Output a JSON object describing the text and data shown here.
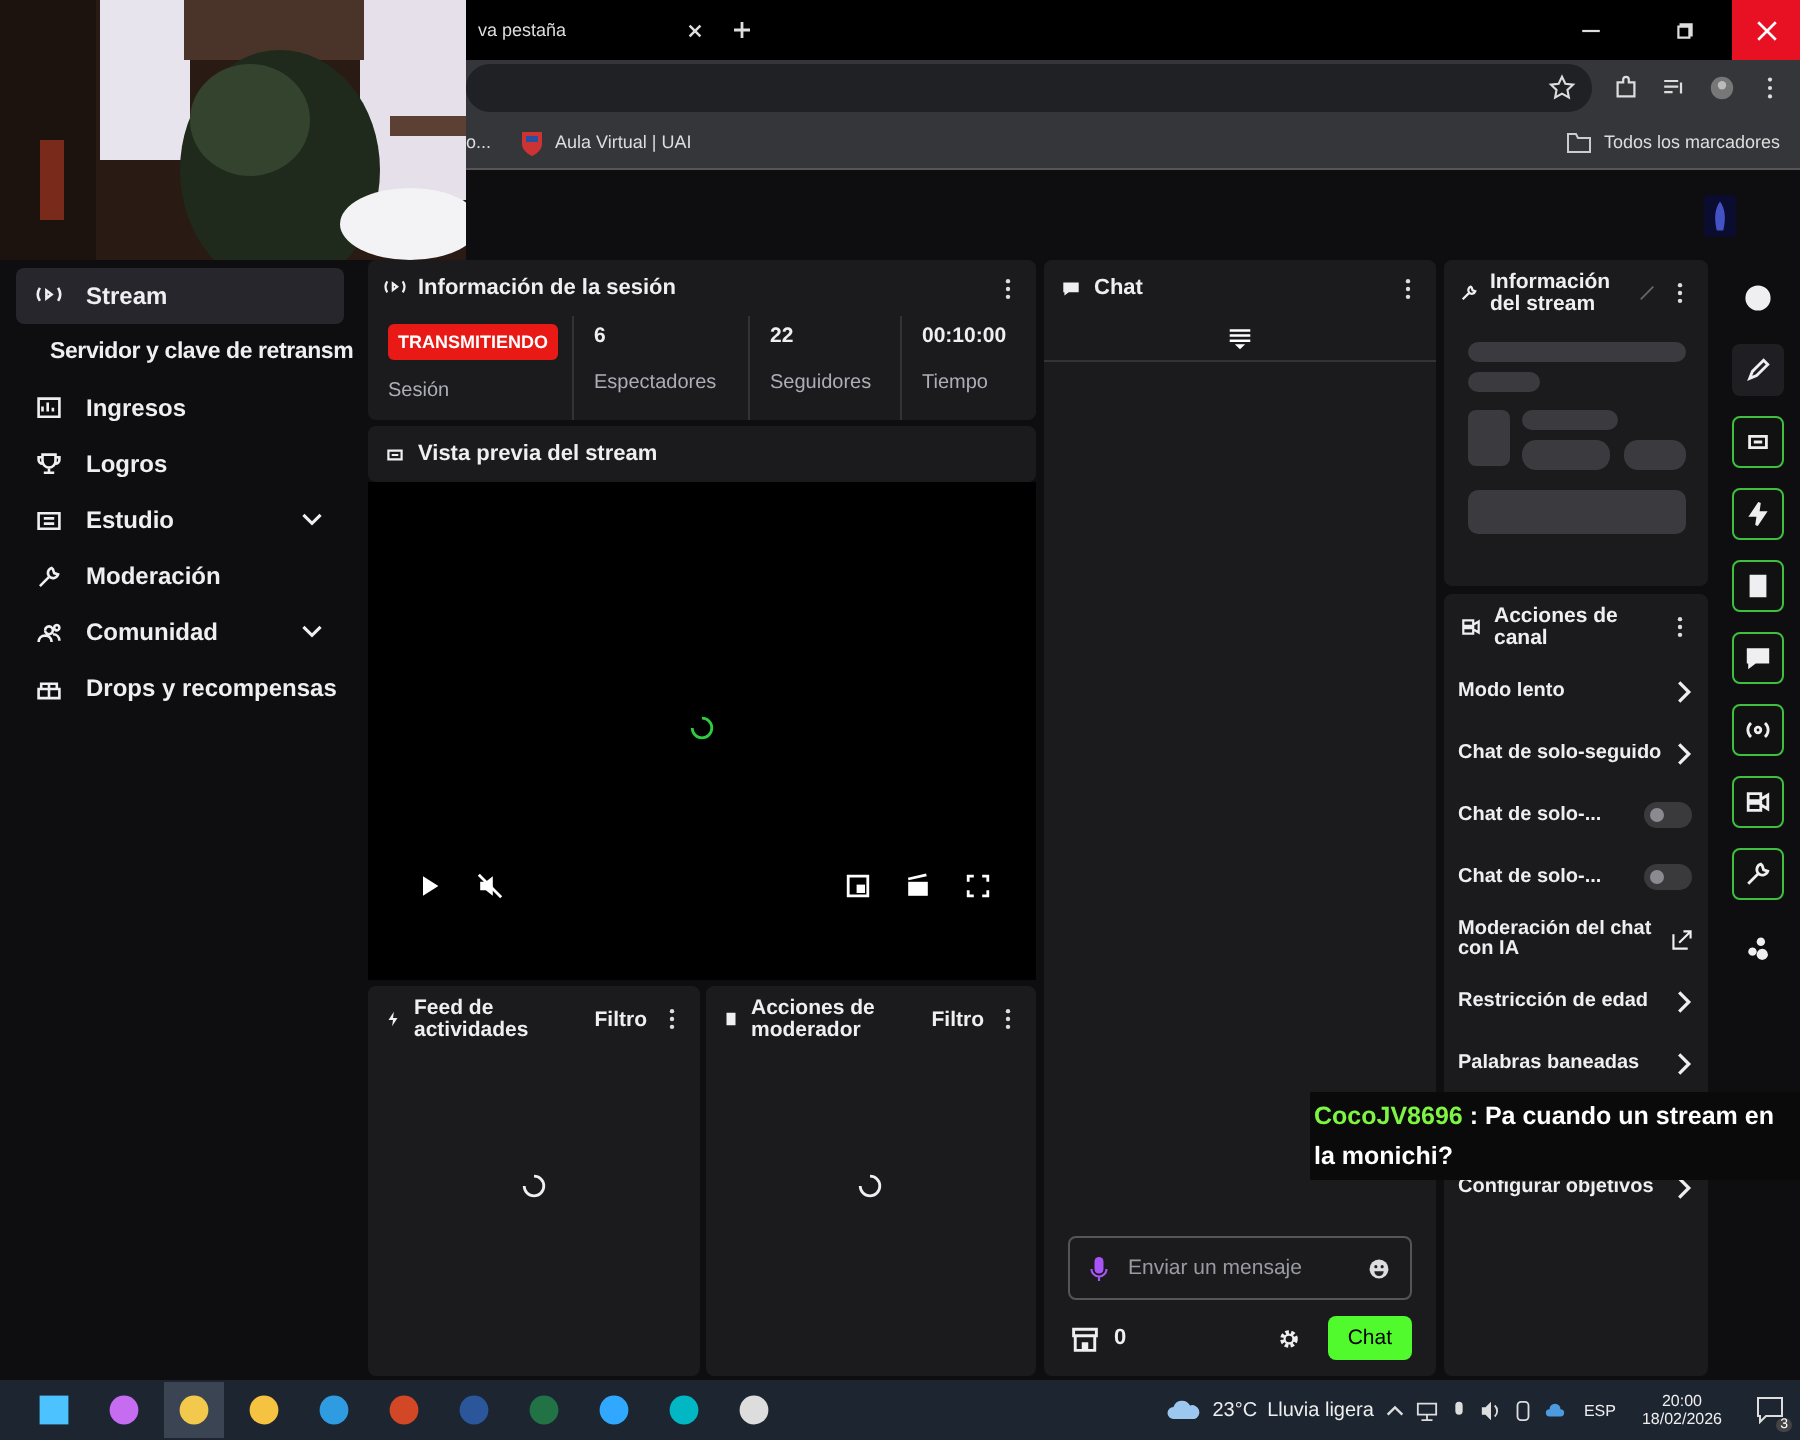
{
  "browser": {
    "tab": {
      "title": "va pestaña"
    },
    "bookmarks": [
      {
        "label": "o..."
      },
      {
        "label": "Aula Virtual | UAI"
      }
    ],
    "all_bookmarks": "Todos los marcadores"
  },
  "sidebar": {
    "items": [
      {
        "label": "Stream",
        "kind": "item",
        "selected": true,
        "expandable": false
      },
      {
        "label": "Servidor y clave de retransm",
        "kind": "subitem",
        "selected": false,
        "expandable": false
      },
      {
        "label": "Ingresos",
        "kind": "item",
        "selected": false,
        "expandable": false
      },
      {
        "label": "Logros",
        "kind": "item",
        "selected": false,
        "expandable": false
      },
      {
        "label": "Estudio",
        "kind": "item",
        "selected": false,
        "expandable": true
      },
      {
        "label": "Moderación",
        "kind": "item",
        "selected": false,
        "expandable": false
      },
      {
        "label": "Comunidad",
        "kind": "item",
        "selected": false,
        "expandable": true
      },
      {
        "label": "Drops y recompensas",
        "kind": "item",
        "selected": false,
        "expandable": false
      }
    ]
  },
  "session": {
    "title": "Información de la sesión",
    "status": "TRANSMITIENDO",
    "status_label": "Sesión",
    "stats": [
      {
        "value": "6",
        "label": "Espectadores"
      },
      {
        "value": "22",
        "label": "Seguidores"
      },
      {
        "value": "00:10:00",
        "label": "Tiempo"
      }
    ]
  },
  "preview": {
    "title": "Vista previa del stream"
  },
  "panels": [
    {
      "title": "Feed de actividades",
      "filter": "Filtro"
    },
    {
      "title": "Acciones de moderador",
      "filter": "Filtro"
    }
  ],
  "chat": {
    "title": "Chat",
    "placeholder": "Enviar un mensaje",
    "points": "0",
    "send": "Chat"
  },
  "stream_info": {
    "title": "Información del stream"
  },
  "channel_actions": {
    "title": "Acciones de canal",
    "items": [
      {
        "label": "Modo lento",
        "kind": "link"
      },
      {
        "label": "Chat de solo-seguido",
        "kind": "link"
      },
      {
        "label": "Chat de solo-...",
        "kind": "toggle",
        "on": false
      },
      {
        "label": "Chat de solo-...",
        "kind": "toggle",
        "on": false
      },
      {
        "label": "Moderación del chat con IA",
        "kind": "external"
      },
      {
        "label": "Restricción de edad",
        "kind": "link"
      },
      {
        "label": "Palabras baneadas",
        "kind": "link"
      },
      {
        "label": "Configurar objetivos",
        "kind": "link"
      }
    ]
  },
  "rail": [
    {
      "active": false
    },
    {
      "active": false
    },
    {
      "active": true
    },
    {
      "active": true
    },
    {
      "active": true
    },
    {
      "active": true
    },
    {
      "active": true
    },
    {
      "active": true
    },
    {
      "active": true
    },
    {
      "active": false
    }
  ],
  "overlay_message": {
    "user": "CocoJV8696",
    "text": ": Pa cuando un stream en la monichi?"
  },
  "taskbar": {
    "temperature": "23°C",
    "weather": "Lluvia ligera",
    "language": "ESP",
    "time": "20:00",
    "date": "18/02/2026",
    "notifications": "3"
  }
}
